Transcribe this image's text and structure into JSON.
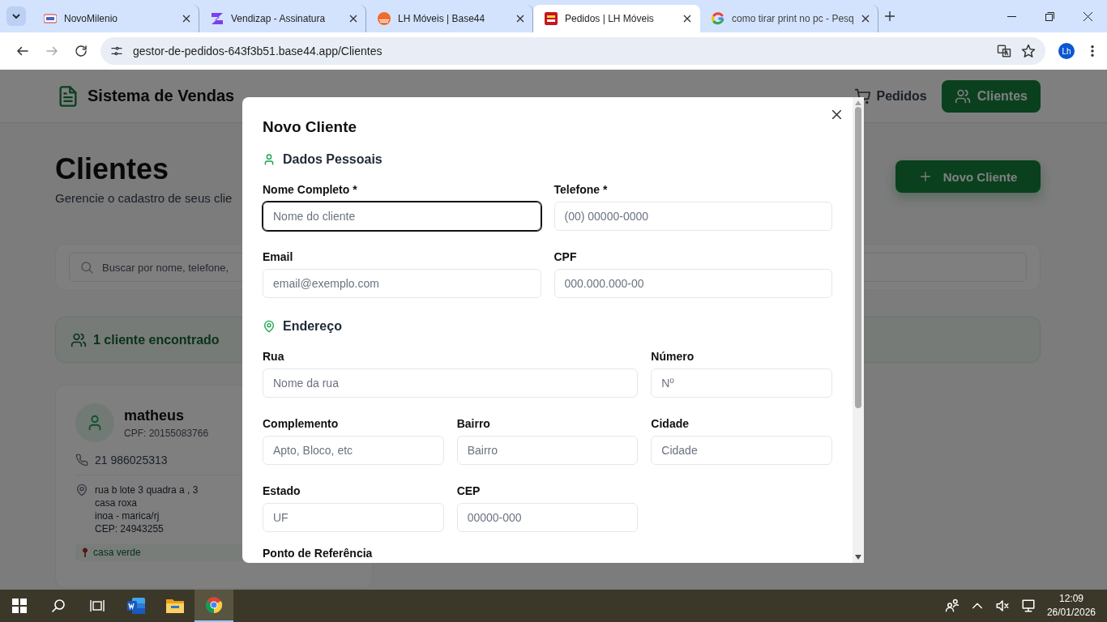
{
  "browser": {
    "tabs": [
      {
        "title": "NovoMilenio",
        "selected": false
      },
      {
        "title": "Vendizap - Assinatura",
        "selected": false
      },
      {
        "title": "LH Móveis | Base44",
        "selected": false
      },
      {
        "title": "Pedidos | LH Móveis",
        "selected": true
      },
      {
        "title": "como tirar print no pc - Pesq",
        "selected": false
      }
    ],
    "url": "gestor-de-pedidos-643f3b51.base44.app/Clientes",
    "profile": "Lh"
  },
  "app": {
    "brand": "Sistema de Vendas",
    "nav": [
      {
        "label": "Pedidos",
        "selected": false
      },
      {
        "label": "Clientes",
        "selected": true
      }
    ],
    "title": "Clientes",
    "subtitle": "Gerencie o cadastro de seus clie",
    "new_button": "Novo Cliente",
    "search": {
      "placeholder": "Buscar por nome, telefone,"
    },
    "count": "1 cliente encontrado",
    "client": {
      "name": "matheus",
      "cpf": "CPF: 20155083766",
      "phone": "21 986025313",
      "address": [
        "rua b lote 3 quadra a , 3",
        "casa roxa",
        "inoa - marica/rj",
        "CEP: 24943255"
      ],
      "reference": "casa verde"
    }
  },
  "modal": {
    "title": "Novo Cliente",
    "sections": [
      {
        "title": "Dados Pessoais",
        "fields": [
          {
            "label": "Nome Completo *",
            "placeholder": "Nome do cliente",
            "focused": true
          },
          {
            "label": "Telefone *",
            "placeholder": "(00) 00000-0000",
            "focused": false
          },
          {
            "label": "Email",
            "placeholder": "email@exemplo.com",
            "focused": false
          },
          {
            "label": "CPF",
            "placeholder": "000.000.000-00",
            "focused": false
          }
        ]
      },
      {
        "title": "Endereço",
        "fields": [
          {
            "label": "Rua",
            "placeholder": "Nome da rua",
            "focused": false
          },
          {
            "label": "Número",
            "placeholder": "Nº",
            "focused": false
          },
          {
            "label": "Complemento",
            "placeholder": "Apto, Bloco, etc",
            "focused": false
          },
          {
            "label": "Bairro",
            "placeholder": "Bairro",
            "focused": false
          },
          {
            "label": "Cidade",
            "placeholder": "Cidade",
            "focused": false
          },
          {
            "label": "Estado",
            "placeholder": "UF",
            "focused": false
          },
          {
            "label": "CEP",
            "placeholder": "00000-000",
            "focused": false
          }
        ]
      }
    ],
    "trailing_label": "Ponto de Referência"
  },
  "taskbar": {
    "apps": [
      {
        "kind": "windows",
        "active": false
      },
      {
        "kind": "search",
        "active": false
      },
      {
        "kind": "taskview",
        "active": false
      },
      {
        "kind": "word",
        "active": false
      },
      {
        "kind": "folder",
        "active": false
      },
      {
        "kind": "chrome",
        "active": true
      }
    ],
    "time": "12:09",
    "date": "26/01/2026"
  }
}
